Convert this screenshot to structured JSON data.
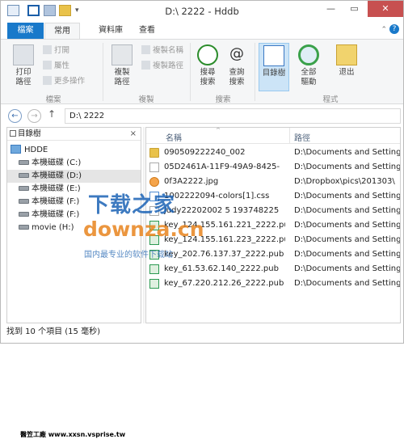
{
  "window": {
    "title": "D:\\ 2222 - Hddb",
    "min_glyph": "—",
    "max_glyph": "▭",
    "close_glyph": "✕"
  },
  "qat": {
    "dropdown_glyph": "▾"
  },
  "tabs": {
    "file": "檔案",
    "home": "常用",
    "share": "資料庫",
    "view": "查看"
  },
  "ribbon": {
    "open": "打開",
    "properties": "屬性",
    "more_actions": "更多操作",
    "print_path_1": "打印",
    "print_path_2": "路徑",
    "copy_path_1": "複製",
    "copy_path_2": "路徑",
    "copy_name": "複製名稱",
    "copy_path": "複製路徑",
    "search_1": "搜尋",
    "search_2": "搜索",
    "query_1": "查詢",
    "query_2": "搜索",
    "panes_label": "目錄樹",
    "all_drives_1": "全部",
    "all_drives_2": "驅動",
    "exit": "退出",
    "groups": {
      "new": "檔案",
      "clipboard": "複製",
      "search": "搜索",
      "view": "程式"
    }
  },
  "nav": {
    "back": "←",
    "forward": "→",
    "up": "↑",
    "address": "D:\\ 2222"
  },
  "tree": {
    "header": "目錄樹",
    "close": "×",
    "root": "HDDE",
    "items": [
      {
        "label": "本機磁碟 (C:)",
        "selected": false
      },
      {
        "label": "本機磁碟 (D:)",
        "selected": true
      },
      {
        "label": "本機磁碟 (E:)",
        "selected": false
      },
      {
        "label": "本機磁碟 (F:)",
        "selected": false
      },
      {
        "label": "本機磁碟 (F:)",
        "selected": false
      },
      {
        "label": "movie (H:)",
        "selected": false
      }
    ],
    "logo_text": "醫笠工廠 www.xxsn.vsprise.tw"
  },
  "list": {
    "col_name": "名稱",
    "col_path": "路徑",
    "sort_glyph": "^",
    "rows": [
      {
        "name": "090509222240_002",
        "path": "D:\\Documents and Setting",
        "type": "folder"
      },
      {
        "name": "05D2461A-11F9-49A9-8425-",
        "path": "D:\\Documents and Setting",
        "type": "doc"
      },
      {
        "name": "0f3A2222.jpg",
        "path": "D:\\Dropbox\\pics\\201303\\",
        "type": "jpg"
      },
      {
        "name": "1002222094-colors[1].css",
        "path": "D:\\Documents and Setting",
        "type": "css"
      },
      {
        "name": "judy22202002 5 193748225",
        "path": "D:\\Documents and Setting",
        "type": "doc"
      },
      {
        "name": "key_124.155.161.221_2222.pub",
        "path": "D:\\Documents and Setting",
        "type": "pub"
      },
      {
        "name": "key_124.155.161.223_2222.pub",
        "path": "D:\\Documents and Setting",
        "type": "pub"
      },
      {
        "name": "key_202.76.137.37_2222.pub",
        "path": "D:\\Documents and Setting",
        "type": "pub"
      },
      {
        "name": "key_61.53.62.140_2222.pub",
        "path": "D:\\Documents and Setting",
        "type": "pub"
      },
      {
        "name": "key_67.220.212.26_2222.pub",
        "path": "D:\\Documents and Setting",
        "type": "pub"
      }
    ]
  },
  "watermark": {
    "line1": "下载之家",
    "line2": "downza.cn",
    "line3": "国内最专业的软件下载站"
  },
  "status": {
    "text": "找到 10 个項目 (15 毫秒)"
  },
  "colors": {
    "accent": "#1979ca",
    "selected_tree": "#e5e5e5",
    "close": "#c75050"
  }
}
